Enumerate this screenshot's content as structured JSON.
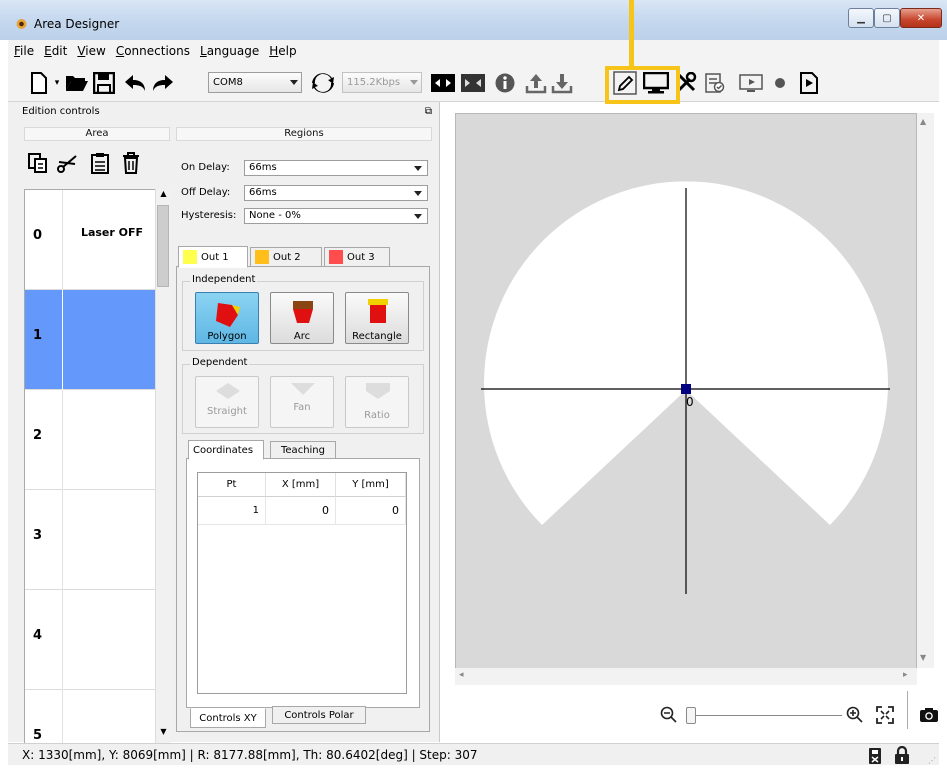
{
  "window": {
    "title": "Area Designer"
  },
  "menu": [
    {
      "label": "File",
      "accel": "F"
    },
    {
      "label": "Edit",
      "accel": "E"
    },
    {
      "label": "View",
      "accel": "V"
    },
    {
      "label": "Connections",
      "accel": "C"
    },
    {
      "label": "Language",
      "accel": "L"
    },
    {
      "label": "Help",
      "accel": "H"
    }
  ],
  "toolbar": {
    "port": "COM8",
    "baud": "115.2Kbps"
  },
  "dock": {
    "title": "Edition controls",
    "area_header": "Area",
    "regions_header": "Regions"
  },
  "areas": [
    {
      "index": "0",
      "name": "Laser OFF"
    },
    {
      "index": "1",
      "name": ""
    },
    {
      "index": "2",
      "name": ""
    },
    {
      "index": "3",
      "name": ""
    },
    {
      "index": "4",
      "name": ""
    },
    {
      "index": "5",
      "name": ""
    }
  ],
  "regions": {
    "on_delay_label": "On Delay:",
    "on_delay_value": "66ms",
    "off_delay_label": "Off Delay:",
    "off_delay_value": "66ms",
    "hysteresis_label": "Hysteresis:",
    "hysteresis_value": "None  - 0%",
    "outputs": [
      {
        "label": "Out 1",
        "color": "#ffff4d"
      },
      {
        "label": "Out 2",
        "color": "#ffbe1a"
      },
      {
        "label": "Out 3",
        "color": "#ff4d4d"
      }
    ],
    "independent_label": "Independent",
    "independent_shapes": [
      "Polygon",
      "Arc",
      "Rectangle"
    ],
    "dependent_label": "Dependent",
    "dependent_shapes": [
      "Straight",
      "Fan",
      "Ratio"
    ],
    "coord_tabs": [
      "Coordinates",
      "Teaching"
    ],
    "columns": [
      "Pt",
      "X [mm]",
      "Y [mm]"
    ],
    "rows": [
      [
        "1",
        "0",
        "0"
      ]
    ],
    "bottom_tabs": [
      "Controls XY",
      "Controls Polar"
    ]
  },
  "canvas": {
    "origin_label": "0",
    "colors": {
      "background": "#d9d9d9",
      "area": "#ffffff",
      "axis": "#000000",
      "origin": "#000080"
    }
  },
  "status": {
    "text": "X: 1330[mm], Y: 8069[mm] | R: 8177.88[mm], Th: 80.6402[deg] | Step: 307"
  },
  "accent": {
    "highlight": "#f7c51a",
    "selection": "#6598fb"
  }
}
